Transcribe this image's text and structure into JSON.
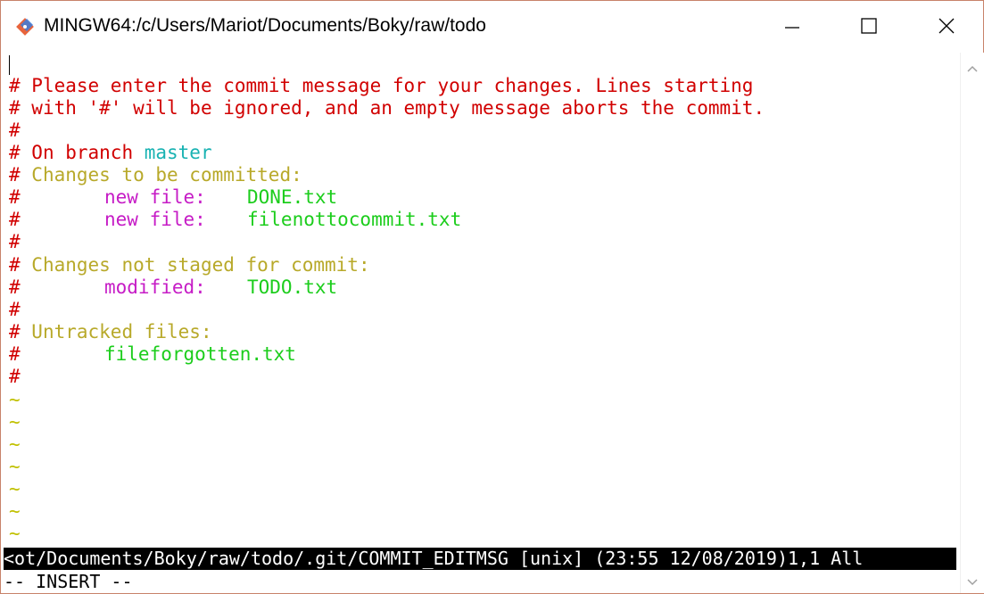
{
  "window": {
    "title": "MINGW64:/c/Users/Mariot/Documents/Boky/raw/todo",
    "icon": "git-bash-icon"
  },
  "controls": {
    "minimize": "minimize-icon",
    "maximize": "maximize-icon",
    "close": "close-icon"
  },
  "editor": {
    "lines": [
      {
        "p1": "# ",
        "t1": "Please enter the commit message for your changes. Lines starting"
      },
      {
        "p1": "# ",
        "t1": "with '#' will be ignored, and an empty message aborts the commit."
      },
      {
        "p1": "#"
      },
      {
        "p1": "# ",
        "t1": "On branch ",
        "branch": "master"
      },
      {
        "p1": "# ",
        "t1": "Changes to be committed:"
      },
      {
        "p1": "#",
        "label": "new file:",
        "file": "DONE.txt"
      },
      {
        "p1": "#",
        "label": "new file:",
        "file": "filenottocommit.txt"
      },
      {
        "p1": "#"
      },
      {
        "p1": "# ",
        "t1": "Changes not staged for commit:"
      },
      {
        "p1": "#",
        "label": "modified:",
        "file": "TODO.txt"
      },
      {
        "p1": "#"
      },
      {
        "p1": "# ",
        "t1": "Untracked files:"
      },
      {
        "p1": "#",
        "file": "fileforgotten.txt"
      },
      {
        "p1": "#"
      }
    ],
    "tildes": [
      "~",
      "~",
      "~",
      "~",
      "~",
      "~",
      "~"
    ]
  },
  "status": {
    "file_line": "<ot/Documents/Boky/raw/todo/.git/COMMIT_EDITMSG [unix] (23:55 12/08/2019)1,1 All",
    "mode": "-- INSERT --"
  },
  "colors": {
    "comment": "#d10000",
    "branch": "#18b2b2",
    "header": "#b8a92a",
    "label": "#c61cc6",
    "file": "#1ccd1c",
    "tilde": "#c0c000"
  }
}
